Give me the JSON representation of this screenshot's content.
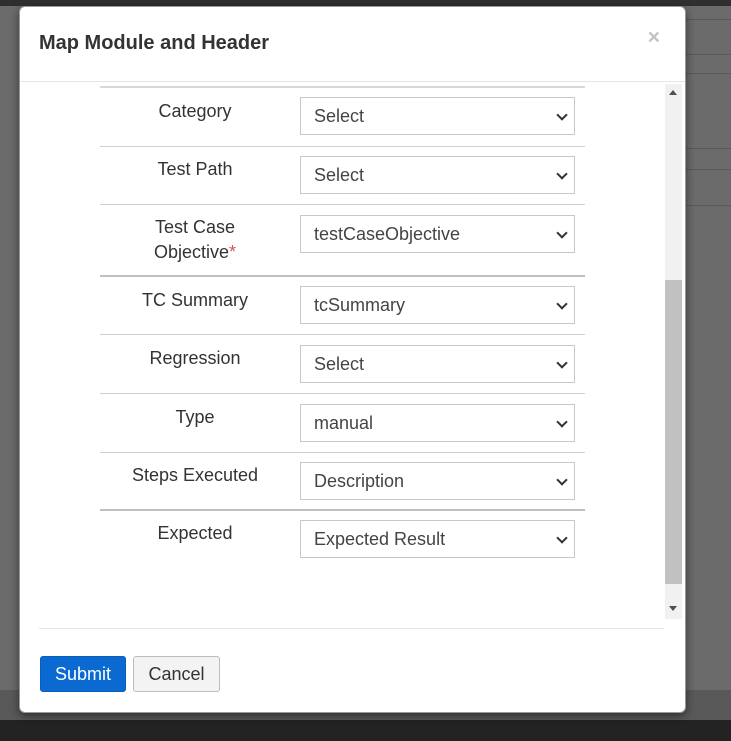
{
  "modal": {
    "title": "Map Module and Header",
    "close_label": "×"
  },
  "form": {
    "rows": [
      {
        "label": "Category",
        "value": "Select"
      },
      {
        "label": "Test Path",
        "value": "Select"
      },
      {
        "label_line1": "Test Case",
        "label_line2": "Objective",
        "required_mark": "*",
        "value": "testCaseObjective"
      },
      {
        "label": "TC Summary",
        "value": "tcSummary"
      },
      {
        "label": "Regression",
        "value": "Select"
      },
      {
        "label": "Type",
        "value": "manual"
      },
      {
        "label": "Steps Executed",
        "value": "Description"
      },
      {
        "label": "Expected",
        "value": "Expected Result"
      }
    ]
  },
  "footer": {
    "submit_label": "Submit",
    "cancel_label": "Cancel"
  },
  "colors": {
    "primary": "#0b6ad1",
    "required": "#d9534f"
  }
}
